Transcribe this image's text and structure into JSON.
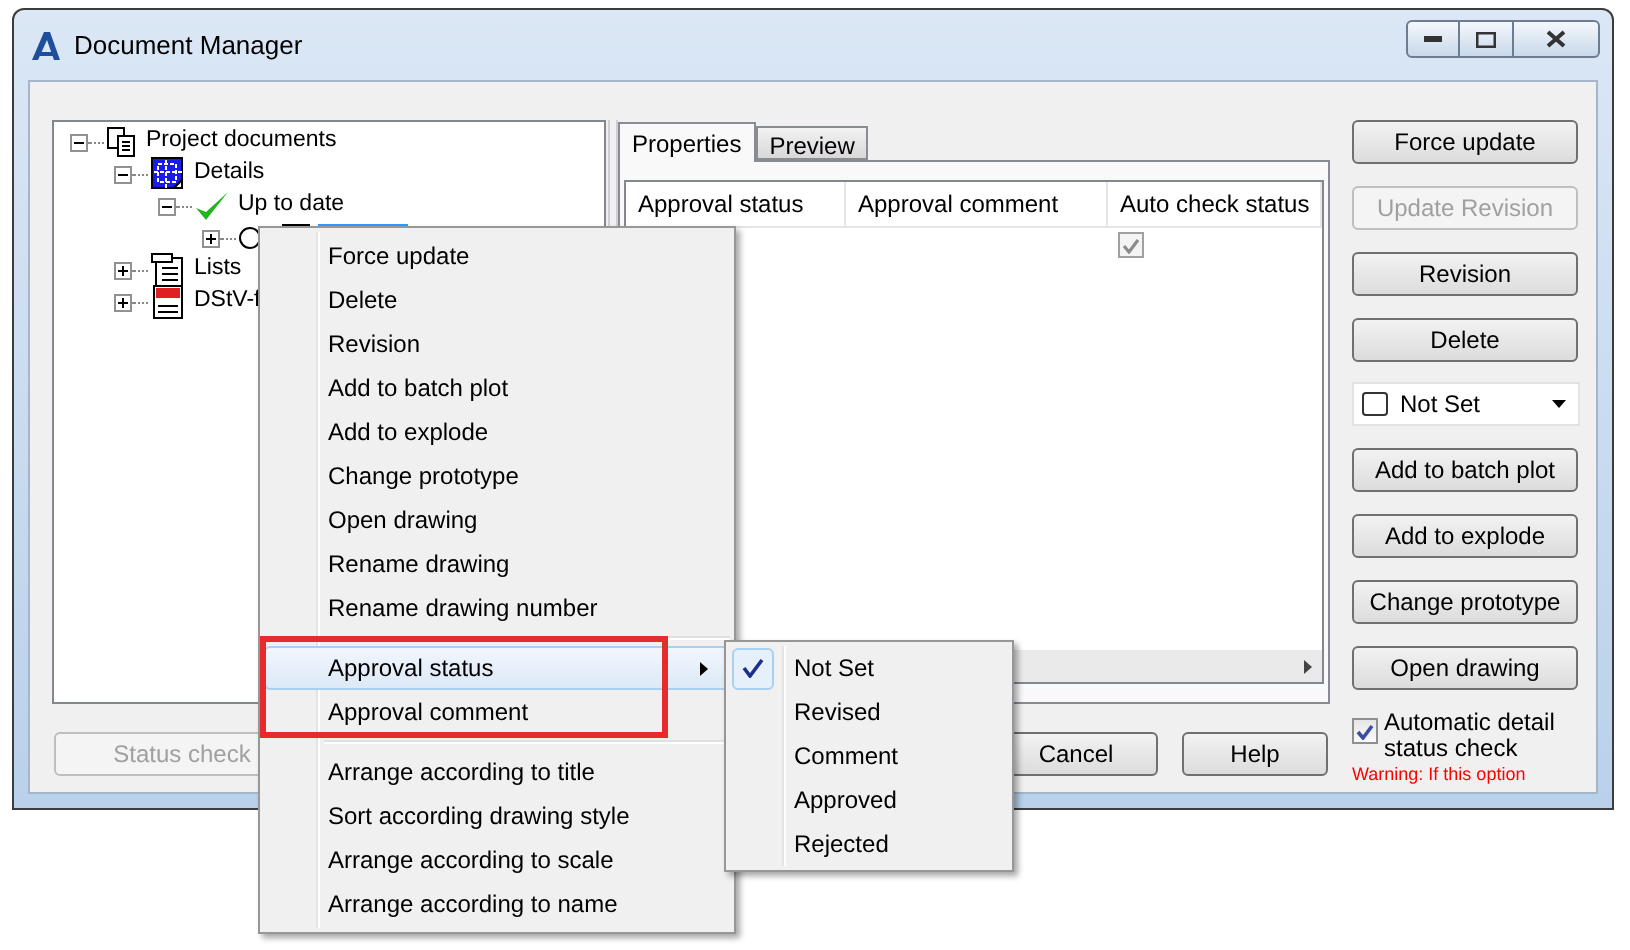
{
  "window": {
    "title": "Document Manager"
  },
  "tree": [
    {
      "label": "Project documents",
      "kind": "documents",
      "expanded": true,
      "selected": false,
      "children": [
        {
          "label": "Details",
          "kind": "details",
          "expanded": true,
          "selected": false,
          "children": [
            {
              "label": "Up to date",
              "kind": "status",
              "expanded": true,
              "selected": false,
              "children": [
                {
                  "kind": "drawing",
                  "expanded": false,
                  "selected": true
                }
              ]
            }
          ]
        },
        {
          "label": "Lists",
          "kind": "lists",
          "expanded": false,
          "selected": false
        },
        {
          "label": "DStV-f",
          "kind": "doc",
          "expanded": false,
          "selected": false
        }
      ]
    }
  ],
  "tabs": [
    {
      "label": "Properties",
      "selected": true
    },
    {
      "label": "Preview",
      "selected": false
    }
  ],
  "table": {
    "columns": [
      "Approval status",
      "Approval comment",
      "Auto check status"
    ],
    "rows": [
      {
        "auto_check": true
      }
    ]
  },
  "side_buttons": [
    {
      "label": "Force update",
      "disabled": false
    },
    {
      "label": "Update Revision",
      "disabled": true
    },
    {
      "label": "Revision",
      "disabled": false
    },
    {
      "label": "Delete",
      "disabled": false
    }
  ],
  "approval_dropdown": {
    "value": "Not Set"
  },
  "side_buttons_2": [
    {
      "label": "Add to batch plot",
      "disabled": false
    },
    {
      "label": "Add to explode",
      "disabled": false
    },
    {
      "label": "Change prototype",
      "disabled": false
    },
    {
      "label": "Open drawing",
      "disabled": false
    }
  ],
  "auto_check": {
    "label": "Automatic detail status check",
    "checked": true
  },
  "warning": "Warning: If this option",
  "bottom_buttons": [
    {
      "label": "Status check",
      "disabled": true
    },
    {
      "label": "Cancel",
      "disabled": false
    },
    {
      "label": "Help",
      "disabled": false
    }
  ],
  "context_menu": [
    {
      "kind": "item",
      "label": "Force update",
      "highlighted": false,
      "submenu": false
    },
    {
      "kind": "item",
      "label": "Delete",
      "highlighted": false,
      "submenu": false
    },
    {
      "kind": "item",
      "label": "Revision",
      "highlighted": false,
      "submenu": false
    },
    {
      "kind": "item",
      "label": "Add to batch plot",
      "highlighted": false,
      "submenu": false
    },
    {
      "kind": "item",
      "label": "Add to explode",
      "highlighted": false,
      "submenu": false
    },
    {
      "kind": "item",
      "label": "Change prototype",
      "highlighted": false,
      "submenu": false
    },
    {
      "kind": "item",
      "label": "Open drawing",
      "highlighted": false,
      "submenu": false
    },
    {
      "kind": "item",
      "label": "Rename drawing",
      "highlighted": false,
      "submenu": false
    },
    {
      "kind": "item",
      "label": "Rename drawing number",
      "highlighted": false,
      "submenu": false
    },
    {
      "kind": "separator"
    },
    {
      "kind": "item",
      "label": "Approval status",
      "highlighted": true,
      "submenu": true
    },
    {
      "kind": "item",
      "label": "Approval comment",
      "highlighted": false,
      "submenu": false
    },
    {
      "kind": "separator"
    },
    {
      "kind": "item",
      "label": "Arrange according to title",
      "highlighted": false,
      "submenu": false
    },
    {
      "kind": "item",
      "label": "Sort according drawing style",
      "highlighted": false,
      "submenu": false
    },
    {
      "kind": "item",
      "label": "Arrange according to scale",
      "highlighted": false,
      "submenu": false
    },
    {
      "kind": "item",
      "label": "Arrange according to name",
      "highlighted": false,
      "submenu": false
    }
  ],
  "submenu": [
    {
      "label": "Not Set",
      "selected": true
    },
    {
      "label": "Revised",
      "selected": false
    },
    {
      "label": "Comment",
      "selected": false
    },
    {
      "label": "Approved",
      "selected": false
    },
    {
      "label": "Rejected",
      "selected": false
    }
  ]
}
